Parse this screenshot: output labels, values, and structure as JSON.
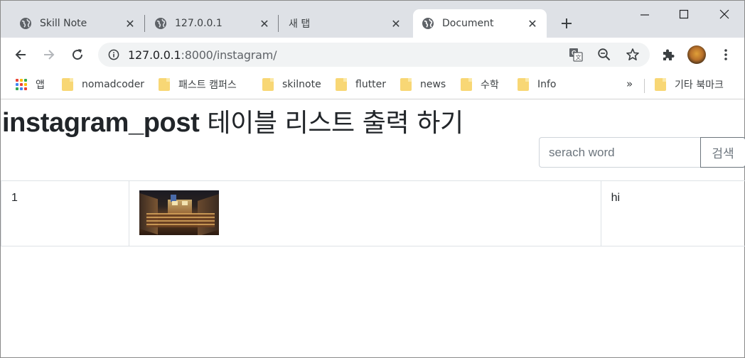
{
  "tabs": [
    {
      "title": "Skill Note",
      "active": false,
      "favicon": "globe-icon"
    },
    {
      "title": "127.0.0.1",
      "active": false,
      "favicon": "globe-icon"
    },
    {
      "title": "새 탭",
      "active": false,
      "favicon": "none"
    },
    {
      "title": "Document",
      "active": true,
      "favicon": "globe-icon"
    }
  ],
  "address": {
    "host": "127.0.0.1",
    "rest": ":8000/instagram/"
  },
  "bookmarks": {
    "apps_label": "앱",
    "items": [
      "nomadcoder",
      "패스트 캠퍼스",
      "skilnote",
      "flutter",
      "news",
      "수학",
      "Info"
    ],
    "more": "»",
    "other": "기타 북마크"
  },
  "page": {
    "heading_bold": "instagram_post",
    "heading_rest": " 테이블 리스트 출력 하기",
    "search": {
      "placeholder": "serach word",
      "button_label": "검색"
    },
    "rows": [
      {
        "id": "1",
        "text": "hi"
      }
    ]
  },
  "colors": {
    "tabstrip": "#dee1e6",
    "accent_text": "#212529",
    "border": "#dee2e6",
    "secondary": "#6c757d"
  }
}
